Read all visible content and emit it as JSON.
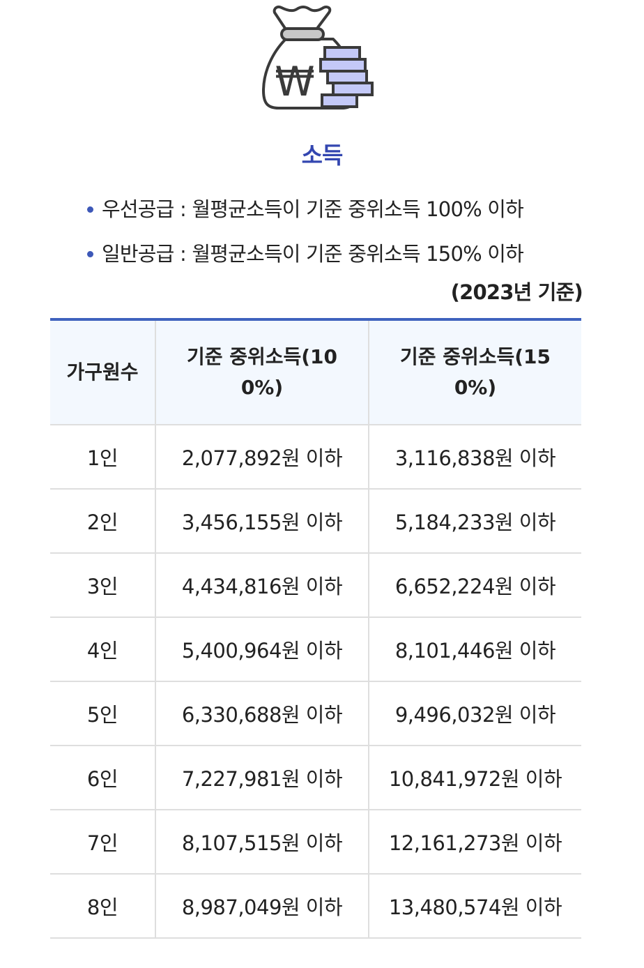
{
  "icon": {
    "name": "money-bag-icon",
    "symbol": "₩",
    "colors": {
      "outline": "#3a3a3a",
      "tie": "#c8c8c8",
      "coins": "#c4c9f7"
    }
  },
  "section": {
    "title": "소득"
  },
  "criteria": [
    {
      "text": "우선공급 : 월평균소득이 기준 중위소득 100% 이하"
    },
    {
      "text": "일반공급 : 월평균소득이 기준 중위소득 150% 이하"
    }
  ],
  "base_year_note": "(2023년 기준)",
  "table": {
    "headers": [
      "가구원수",
      "기준 중위소득(100%)",
      "기준 중위소득(150%)"
    ],
    "rows": [
      [
        "1인",
        "2,077,892원 이하",
        "3,116,838원 이하"
      ],
      [
        "2인",
        "3,456,155원 이하",
        "5,184,233원 이하"
      ],
      [
        "3인",
        "4,434,816원 이하",
        "6,652,224원 이하"
      ],
      [
        "4인",
        "5,400,964원 이하",
        "8,101,446원 이하"
      ],
      [
        "5인",
        "6,330,688원 이하",
        "9,496,032원 이하"
      ],
      [
        "6인",
        "7,227,981원 이하",
        "10,841,972원 이하"
      ],
      [
        "7인",
        "8,107,515원 이하",
        "12,161,273원 이하"
      ],
      [
        "8인",
        "8,987,049원 이하",
        "13,480,574원 이하"
      ]
    ]
  },
  "colors": {
    "accent": "#3346b0",
    "table_top_border": "#3f62be",
    "header_background": "#f3f8fe",
    "grid": "#dedede",
    "bullet": "#3d58b8"
  }
}
